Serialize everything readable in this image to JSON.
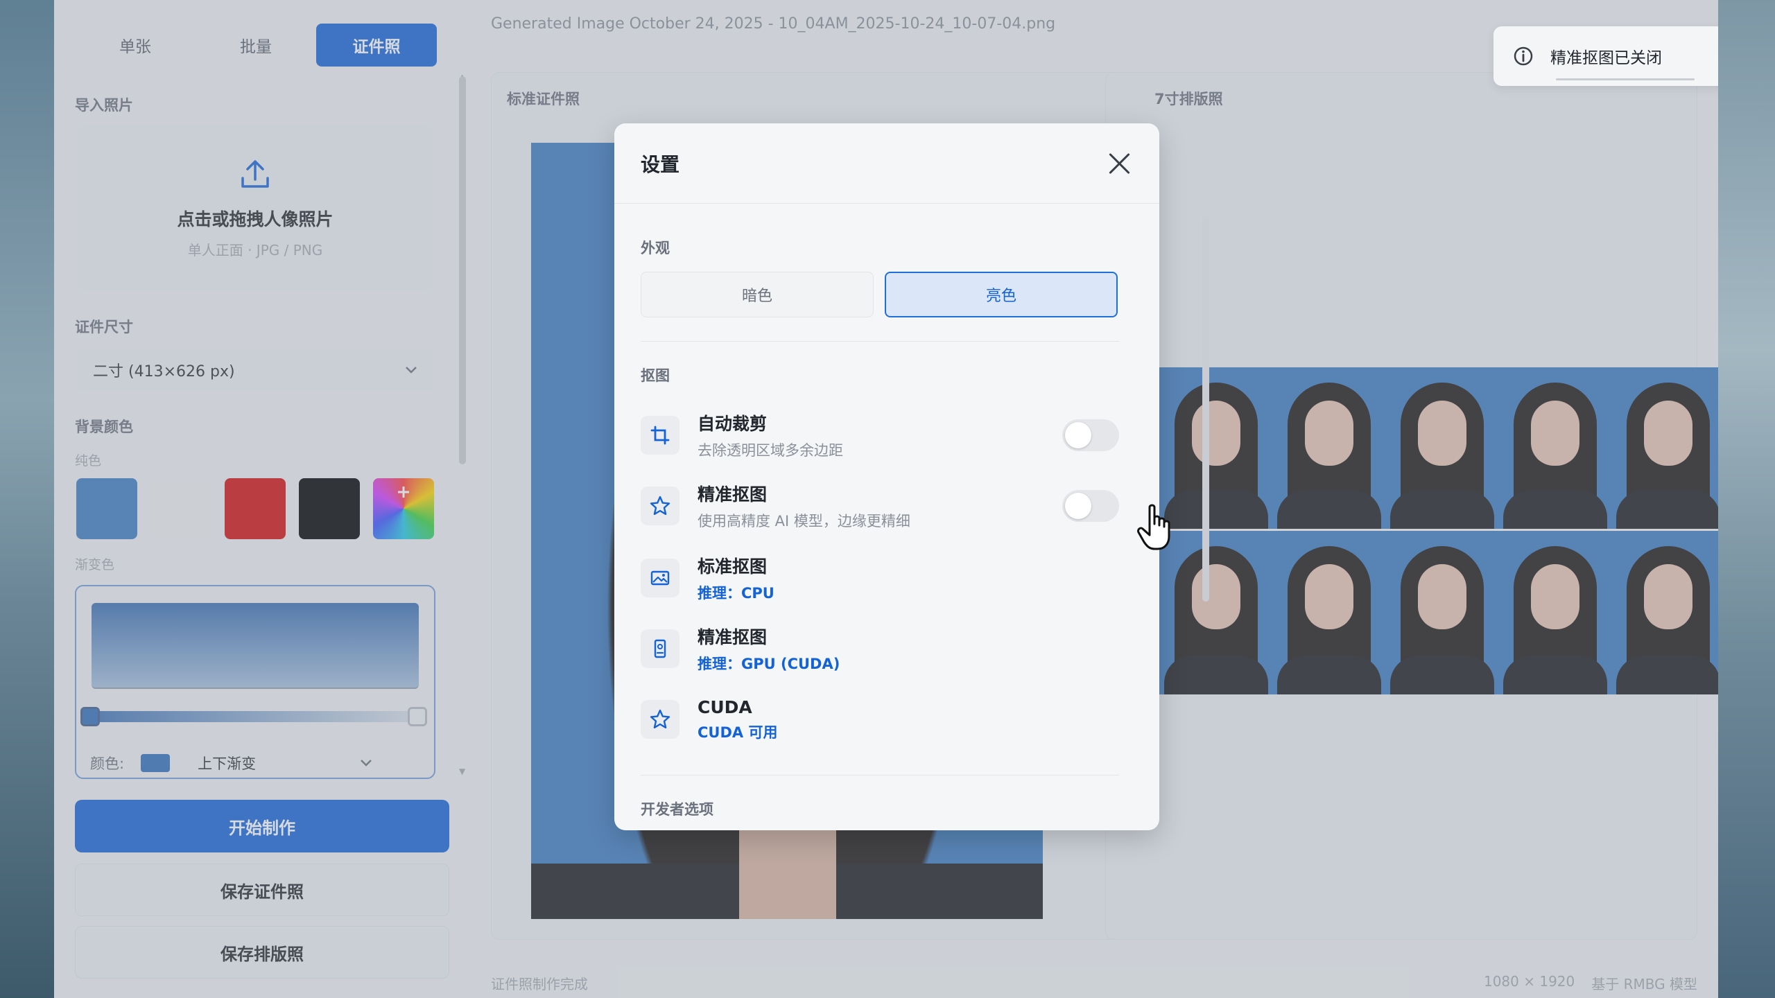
{
  "sidebar": {
    "tabs": [
      {
        "label": "单张",
        "active": false
      },
      {
        "label": "批量",
        "active": false
      },
      {
        "label": "证件照",
        "active": true
      }
    ],
    "import_label": "导入照片",
    "upload_title": "点击或拖拽人像照片",
    "upload_sub": "单人正面 · JPG / PNG",
    "size_label": "证件尺寸",
    "size_value": "二寸 (413×626 px)",
    "bg_label": "背景颜色",
    "solid_label": "纯色",
    "swatches": [
      "#3d7cc0",
      "#eeeeee",
      "#d20f0f",
      "#000000",
      "rainbow"
    ],
    "gradient_label": "渐变色",
    "gradient_color_label": "颜色:",
    "gradient_type": "上下渐变",
    "start_button": "开始制作",
    "save_id_button": "保存证件照",
    "save_layout_button": "保存排版照"
  },
  "main": {
    "file_title": "Generated Image October 24, 2025 - 10_04AM_2025-10-24_10-07-04.png",
    "panel_left_title": "标准证件照",
    "panel_right_title": "7寸排版照",
    "status": "证件照制作完成",
    "resolution": "1080 × 1920",
    "model": "基于 RMBG 模型"
  },
  "toast": {
    "text": "精准抠图已关闭"
  },
  "modal": {
    "title": "设置",
    "appearance_label": "外观",
    "theme_dark": "暗色",
    "theme_light": "亮色",
    "matting_label": "抠图",
    "rows": [
      {
        "title": "自动裁剪",
        "sub": "去除透明区域多余边距",
        "toggle": false
      },
      {
        "title": "精准抠图",
        "sub": "使用高精度 AI 模型，边缘更精细",
        "toggle": false
      },
      {
        "title": "标准抠图",
        "sub": "推理：CPU"
      },
      {
        "title": "精准抠图",
        "sub": "推理：GPU (CUDA)"
      },
      {
        "title": "CUDA",
        "sub": "CUDA 可用"
      }
    ],
    "dev_label": "开发者选项"
  },
  "colors": {
    "accent": "#1463d6",
    "photo_bg": "#3d7cc0"
  }
}
